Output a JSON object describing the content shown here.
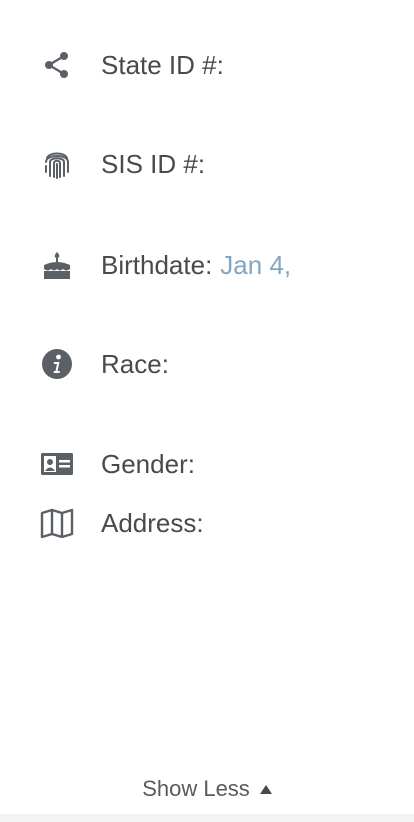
{
  "fields": {
    "state_id": {
      "label": "State ID #:",
      "value": ""
    },
    "sis_id": {
      "label": "SIS ID #:",
      "value": ""
    },
    "birthdate": {
      "label": "Birthdate:",
      "value": "Jan 4,"
    },
    "race": {
      "label": "Race:",
      "value": ""
    },
    "gender": {
      "label": "Gender:",
      "value": ""
    },
    "address": {
      "label": "Address:",
      "value": ""
    }
  },
  "icons": {
    "state_id": "share-icon",
    "sis_id": "fingerprint-icon",
    "birthdate": "birthday-cake-icon",
    "race": "info-circle-icon",
    "gender": "id-card-icon",
    "address": "map-icon"
  },
  "footer": {
    "toggle_label": "Show Less",
    "toggle_icon": "caret-up-icon"
  },
  "colors": {
    "text": "#4a4a4a",
    "accent": "#7fa7c4",
    "icon": "#5b5f66"
  }
}
